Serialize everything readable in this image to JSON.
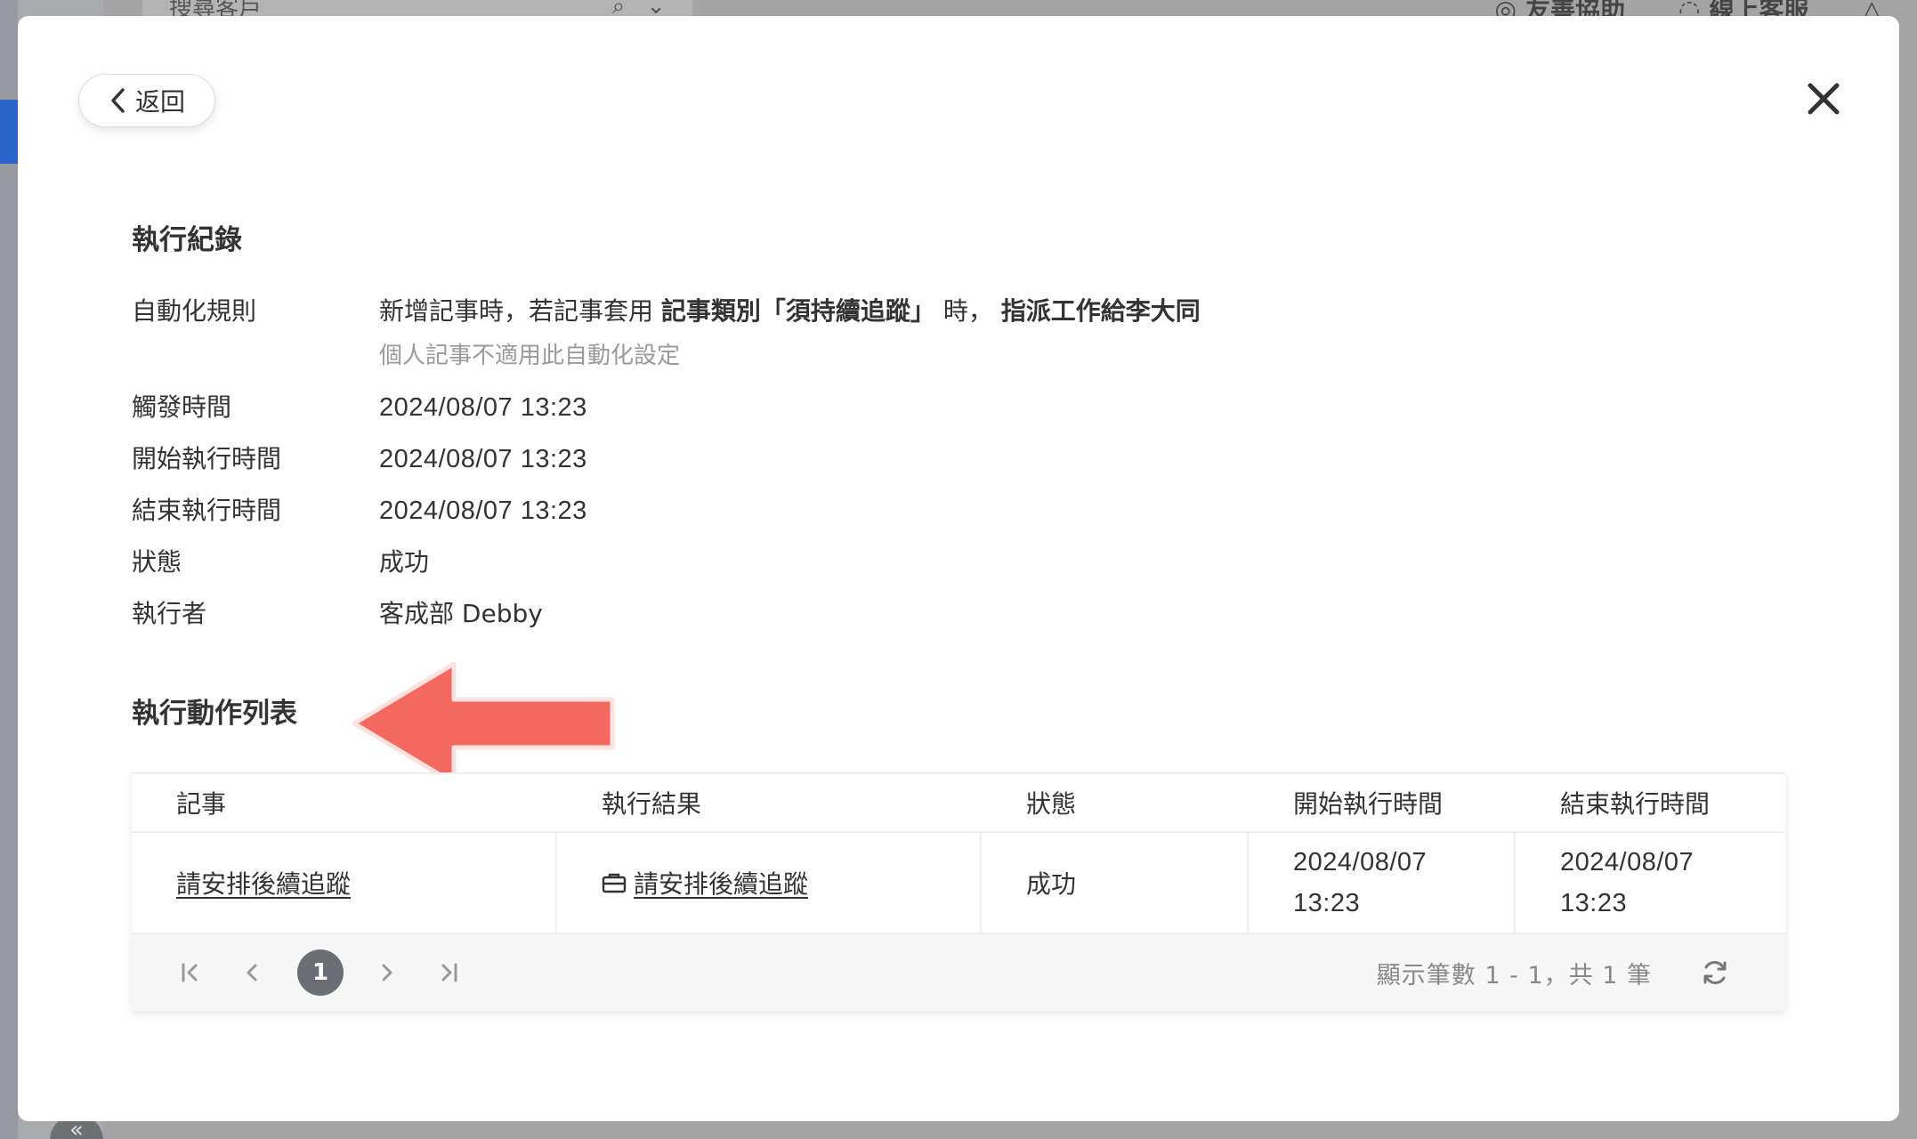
{
  "background": {
    "search_placeholder": "搜尋客戶",
    "top_links": [
      "友善協助",
      "線上客服"
    ]
  },
  "modal": {
    "back_label": "返回",
    "record_title": "執行紀錄",
    "info": {
      "rule_label": "自動化規則",
      "rule_text_1": "新增記事時，若記事套用",
      "rule_bold_1": "記事類別「須持續追蹤」",
      "rule_text_2": "時，",
      "rule_bold_2": "指派工作給李大同",
      "rule_note": "個人記事不適用此自動化設定",
      "trigger_label": "觸發時間",
      "trigger_value": "2024/08/07 13:23",
      "start_label": "開始執行時間",
      "start_value": "2024/08/07 13:23",
      "end_label": "結束執行時間",
      "end_value": "2024/08/07 13:23",
      "status_label": "狀態",
      "status_value": "成功",
      "executor_label": "執行者",
      "executor_value": "客成部 Debby"
    },
    "actions_title": "執行動作列表",
    "table": {
      "headers": [
        "記事",
        "執行結果",
        "狀態",
        "開始執行時間",
        "結束執行時間"
      ],
      "rows": [
        {
          "note": "請安排後續追蹤",
          "result": "請安排後續追蹤",
          "status": "成功",
          "start_date": "2024/08/07",
          "start_time": "13:23",
          "end_date": "2024/08/07",
          "end_time": "13:23"
        }
      ]
    },
    "pager": {
      "current_page": "1",
      "count_text": "顯示筆數 1 - 1，共 1 筆"
    }
  },
  "colors": {
    "arrow": "#f4695f",
    "page_badge": "#6b6e75",
    "accent": "#2a64c8"
  }
}
